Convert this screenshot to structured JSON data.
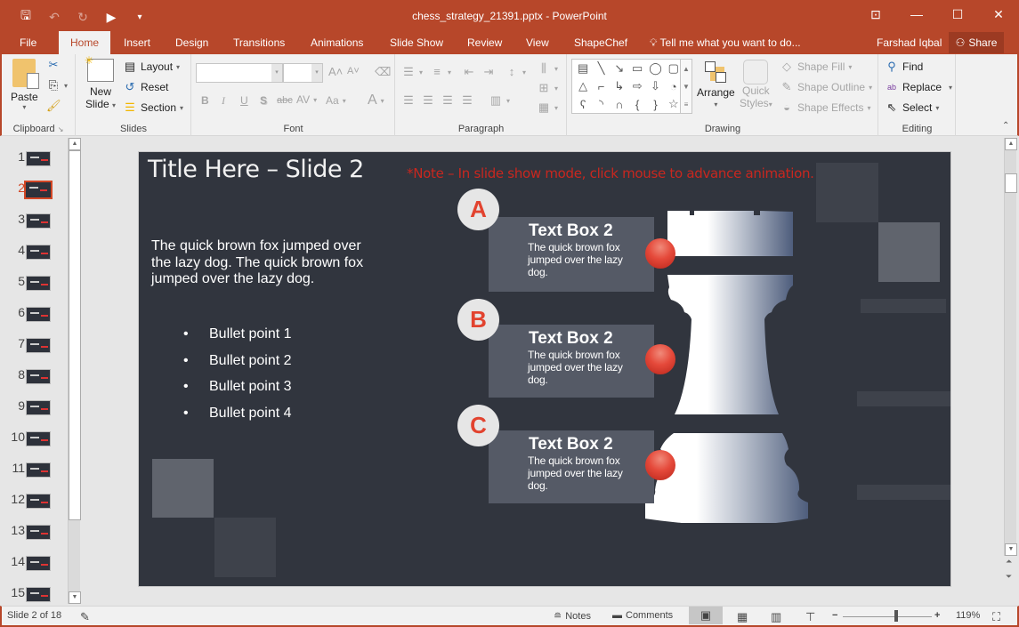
{
  "app": {
    "window_title": "chess_strategy_21391.pptx - PowerPoint",
    "colors": {
      "brand": "#b7472a",
      "slide_bg": "#31353e",
      "accent_red": "#e2432f",
      "note_red": "#c8271f",
      "textbox_bg": "#555a66"
    }
  },
  "qat": [
    {
      "name": "save-icon",
      "glyph": "🖫"
    },
    {
      "name": "undo-icon",
      "glyph": "↶"
    },
    {
      "name": "redo-icon",
      "glyph": "↻"
    },
    {
      "name": "present-icon",
      "glyph": "▶"
    },
    {
      "name": "customize-icon",
      "glyph": "▾"
    }
  ],
  "window_controls": {
    "restore_ribbon": "⊡",
    "minimize": "—",
    "maximize": "☐",
    "close": "✕"
  },
  "tabs": [
    "File",
    "Home",
    "Insert",
    "Design",
    "Transitions",
    "Animations",
    "Slide Show",
    "Review",
    "View",
    "ShapeChef"
  ],
  "active_tab": "Home",
  "tell_me": "Tell me what you want to do...",
  "user": "Farshad Iqbal",
  "share": "Share",
  "ribbon": {
    "clipboard": {
      "label": "Clipboard",
      "paste": "Paste"
    },
    "slides": {
      "label": "Slides",
      "new_slide_1": "New",
      "new_slide_2": "Slide",
      "layout": "Layout",
      "reset": "Reset",
      "section": "Section"
    },
    "font": {
      "label": "Font",
      "font_name": "",
      "font_size": "",
      "bold": "B",
      "italic": "I",
      "underline": "U",
      "shadow": "S",
      "strike": "abc",
      "spacing": "AV",
      "case": "Aa",
      "color": "A",
      "grow": "A˄",
      "shrink": "A˅"
    },
    "paragraph": {
      "label": "Paragraph"
    },
    "drawing": {
      "label": "Drawing",
      "arrange": "Arrange",
      "quick_styles_1": "Quick",
      "quick_styles_2": "Styles",
      "shape_fill": "Shape Fill",
      "shape_outline": "Shape Outline",
      "shape_effects": "Shape Effects",
      "shapes": [
        "▤",
        "╲",
        "↘",
        "▭",
        "◯",
        "▢",
        "△",
        "⌐",
        "↳",
        "⇨",
        "⇩",
        "◔",
        "ʕ",
        "◝",
        "∩",
        "{",
        "}",
        "☆"
      ]
    },
    "editing": {
      "label": "Editing",
      "find": "Find",
      "replace": "Replace",
      "select": "Select"
    }
  },
  "thumbnails": {
    "numbers": [
      "1",
      "2",
      "3",
      "4",
      "5",
      "6",
      "7",
      "8",
      "9",
      "10",
      "11",
      "12",
      "13",
      "14",
      "15"
    ],
    "active_index": 1
  },
  "slide": {
    "title": "Title Here – Slide 2",
    "note": "*Note – In slide show mode, click mouse to advance animation.",
    "body": "The quick brown fox jumped over the lazy dog. The quick brown fox jumped over the lazy dog.",
    "bullets": [
      "Bullet point 1",
      "Bullet point 2",
      "Bullet point 3",
      "Bullet point 4"
    ],
    "items": [
      {
        "badge": "A",
        "heading": "Text Box 2",
        "text": "The quick brown fox jumped over the lazy dog."
      },
      {
        "badge": "B",
        "heading": "Text Box 2",
        "text": "The quick brown fox jumped over the lazy dog."
      },
      {
        "badge": "C",
        "heading": "Text Box 2",
        "text": "The quick brown fox jumped over the lazy dog."
      }
    ]
  },
  "status": {
    "slide_info": "Slide 2 of 18",
    "notes": "Notes",
    "comments": "Comments",
    "zoom": "119%",
    "zoom_fraction": 0.6
  }
}
